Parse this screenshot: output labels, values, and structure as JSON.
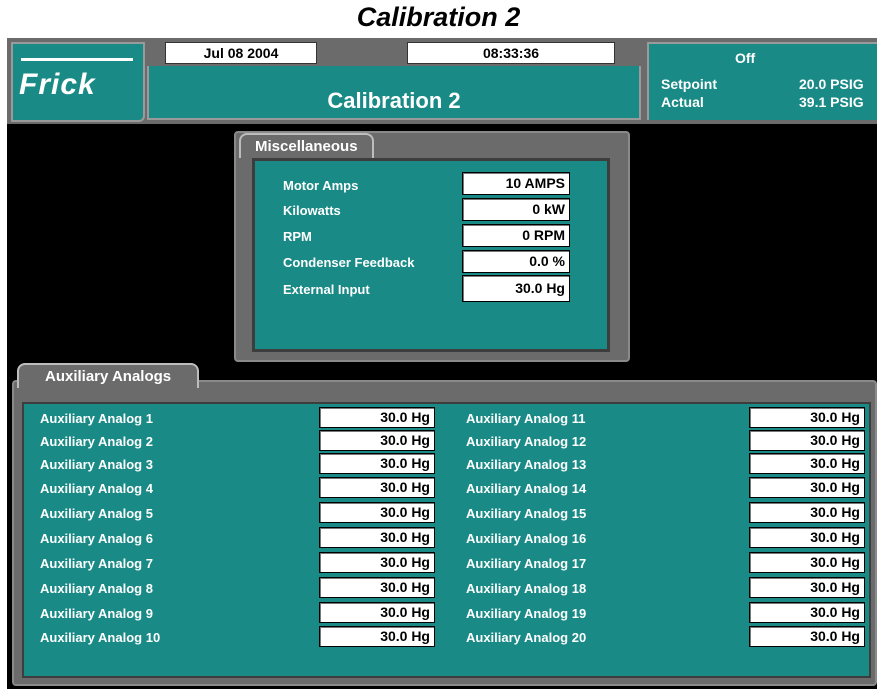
{
  "page_title": "Calibration 2",
  "header": {
    "logo": "Frick",
    "date": "Jul 08 2004",
    "time": "08:33:36",
    "screen_title": "Calibration 2",
    "status": "Off",
    "setpoint_label": "Setpoint",
    "setpoint_value": "20.0 PSIG",
    "actual_label": "Actual",
    "actual_value": "39.1 PSIG"
  },
  "miscellaneous": {
    "title": "Miscellaneous",
    "rows": [
      {
        "label": "Motor Amps",
        "value": "10 AMPS"
      },
      {
        "label": "Kilowatts",
        "value": "0 kW"
      },
      {
        "label": "RPM",
        "value": "0 RPM"
      },
      {
        "label": "Condenser Feedback",
        "value": "0.0 %"
      },
      {
        "label": "External Input",
        "value": "30.0 Hg"
      }
    ]
  },
  "auxiliary": {
    "title": "Auxiliary Analogs",
    "left": [
      {
        "label": "Auxiliary Analog 1",
        "value": "30.0 Hg"
      },
      {
        "label": "Auxiliary Analog 2",
        "value": "30.0 Hg"
      },
      {
        "label": "Auxiliary Analog 3",
        "value": "30.0 Hg"
      },
      {
        "label": "Auxiliary Analog 4",
        "value": "30.0 Hg"
      },
      {
        "label": "Auxiliary Analog 5",
        "value": "30.0 Hg"
      },
      {
        "label": "Auxiliary Analog 6",
        "value": "30.0 Hg"
      },
      {
        "label": "Auxiliary Analog 7",
        "value": "30.0 Hg"
      },
      {
        "label": "Auxiliary Analog 8",
        "value": "30.0 Hg"
      },
      {
        "label": "Auxiliary Analog 9",
        "value": "30.0 Hg"
      },
      {
        "label": "Auxiliary Analog 10",
        "value": "30.0 Hg"
      }
    ],
    "right": [
      {
        "label": "Auxiliary Analog 11",
        "value": "30.0 Hg"
      },
      {
        "label": "Auxiliary Analog 12",
        "value": "30.0 Hg"
      },
      {
        "label": "Auxiliary Analog 13",
        "value": "30.0 Hg"
      },
      {
        "label": "Auxiliary Analog 14",
        "value": "30.0 Hg"
      },
      {
        "label": "Auxiliary Analog 15",
        "value": "30.0 Hg"
      },
      {
        "label": "Auxiliary Analog 16",
        "value": "30.0 Hg"
      },
      {
        "label": "Auxiliary Analog 17",
        "value": "30.0 Hg"
      },
      {
        "label": "Auxiliary Analog 18",
        "value": "30.0 Hg"
      },
      {
        "label": "Auxiliary Analog 19",
        "value": "30.0 Hg"
      },
      {
        "label": "Auxiliary Analog 20",
        "value": "30.0 Hg"
      }
    ]
  },
  "colors": {
    "panel": "#198a86",
    "frame": "#6b6b6b",
    "background": "#000000"
  }
}
